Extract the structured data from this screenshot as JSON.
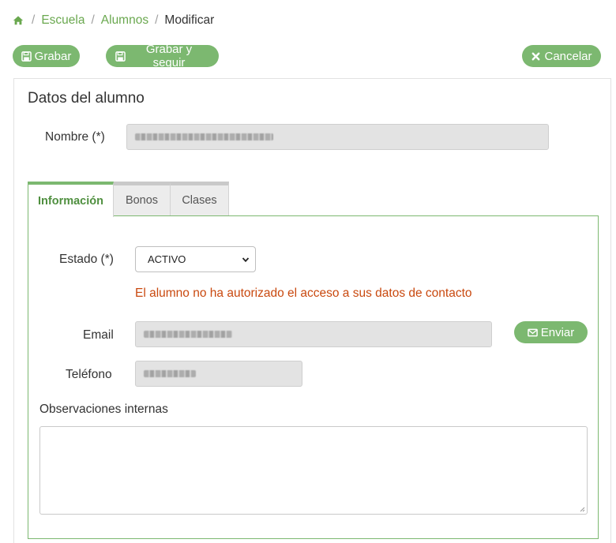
{
  "breadcrumb": {
    "items": [
      "Escuela",
      "Alumnos"
    ],
    "current": "Modificar"
  },
  "toolbar": {
    "save_label": "Grabar",
    "save_continue_label": "Grabar y seguir",
    "cancel_label": "Cancelar"
  },
  "panel": {
    "title": "Datos del alumno",
    "name_label": "Nombre (*)"
  },
  "tabs": [
    {
      "label": "Información",
      "active": true
    },
    {
      "label": "Bonos",
      "active": false
    },
    {
      "label": "Clases",
      "active": false
    }
  ],
  "info": {
    "status_label": "Estado (*)",
    "status_value": "ACTIVO",
    "warning": "El alumno no ha autorizado el acceso a sus datos de contacto",
    "email_label": "Email",
    "send_label": "Enviar",
    "phone_label": "Teléfono",
    "notes_label": "Observaciones internas"
  },
  "colors": {
    "accent": "#7cb870",
    "link": "#6aa84f",
    "warning": "#c9490f"
  }
}
